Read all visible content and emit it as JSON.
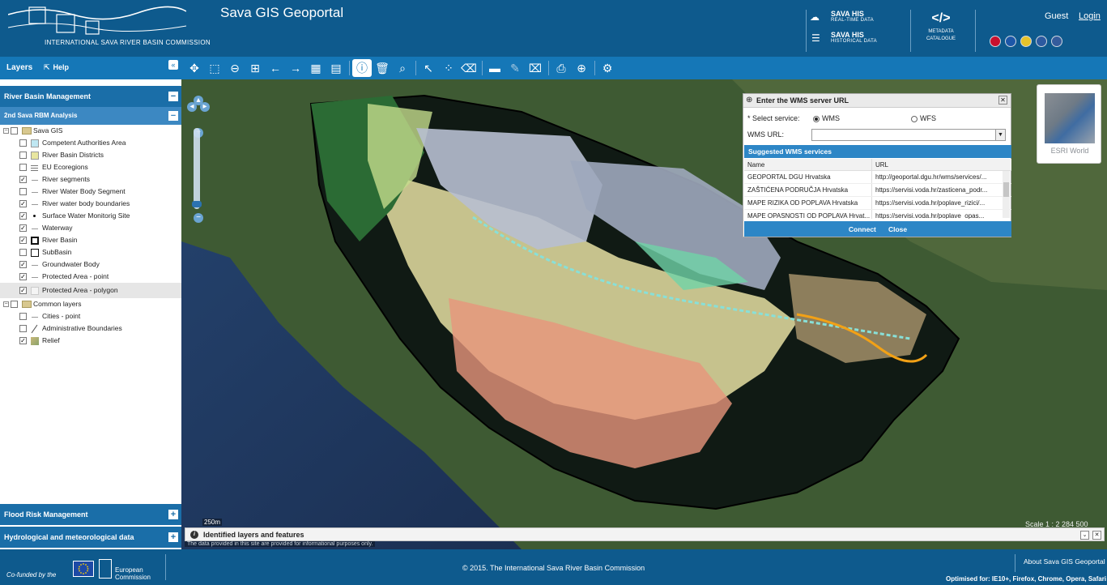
{
  "header": {
    "org_name": "INTERNATIONAL SAVA RIVER BASIN COMMISSION",
    "app_title": "Sava GIS Geoportal",
    "his_realtime": {
      "title": "SAVA HIS",
      "subtitle": "REAL-TIME DATA"
    },
    "his_historical": {
      "title": "SAVA HIS",
      "subtitle": "HISTORICAL DATA"
    },
    "metadata": {
      "glyph": "</>",
      "line1": "METADATA",
      "line2": "CATALOGUE"
    },
    "user": "Guest",
    "login": "Login",
    "flags": [
      "#c8102e",
      "#1d57a8",
      "#e6c229",
      "#2c5aa0",
      "#355c9c"
    ]
  },
  "toolbar": {
    "layers_tab": "Layers",
    "help_tab": "Help",
    "collapse": "«",
    "tools": [
      {
        "name": "pan-icon",
        "glyph": "✥"
      },
      {
        "name": "zoom-box-icon",
        "glyph": "⬚"
      },
      {
        "name": "zoom-out-icon",
        "glyph": "⊖"
      },
      {
        "name": "zoom-extent-icon",
        "glyph": "⊞"
      },
      {
        "name": "back-icon",
        "glyph": "←"
      },
      {
        "name": "forward-icon",
        "glyph": "→"
      },
      {
        "name": "map-icon",
        "glyph": "▦"
      },
      {
        "name": "table-icon",
        "glyph": "▤"
      },
      {
        "name": "info-icon",
        "glyph": "ⓘ",
        "active": true
      },
      {
        "name": "delete-icon",
        "glyph": "🗑"
      },
      {
        "name": "search-icon",
        "glyph": "⌕"
      },
      {
        "name": "select-icon",
        "glyph": "↖"
      },
      {
        "name": "select-area-icon",
        "glyph": "⁘"
      },
      {
        "name": "clear-selection-icon",
        "glyph": "⌫"
      },
      {
        "name": "measure-icon",
        "glyph": "▬"
      },
      {
        "name": "draw-icon",
        "glyph": "✎",
        "dim": true
      },
      {
        "name": "erase-icon",
        "glyph": "⌧"
      },
      {
        "name": "print-icon",
        "glyph": "⎙"
      },
      {
        "name": "globe-icon",
        "glyph": "⊕"
      },
      {
        "name": "gear-icon",
        "glyph": "⚙"
      }
    ]
  },
  "sidebar": {
    "river_basin": "River Basin Management",
    "rbm_analysis": "2nd Sava RBM Analysis",
    "flood_risk": "Flood Risk Management",
    "hydro": "Hydrological and meteorological data",
    "tree": [
      {
        "label": "Sava GIS",
        "level": 0,
        "folder": true,
        "checked": false
      },
      {
        "label": "Competent Authorities Area",
        "level": 1,
        "checked": false,
        "sym": "#bfe7f2"
      },
      {
        "label": "River Basin Districts",
        "level": 1,
        "checked": false,
        "sym": "#e8e6a0"
      },
      {
        "label": "EU Ecoregions",
        "level": 1,
        "checked": false,
        "sym": "lines"
      },
      {
        "label": "River segments",
        "level": 1,
        "checked": true,
        "sym": "line"
      },
      {
        "label": "River Water Body Segment",
        "level": 1,
        "checked": false,
        "sym": "line"
      },
      {
        "label": "River water body boundaries",
        "level": 1,
        "checked": true,
        "sym": "line"
      },
      {
        "label": "Surface Water Monitorig Site",
        "level": 1,
        "checked": true,
        "sym": "dot"
      },
      {
        "label": "Waterway",
        "level": 1,
        "checked": true,
        "sym": "line"
      },
      {
        "label": "River Basin",
        "level": 1,
        "checked": true,
        "sym": "bold"
      },
      {
        "label": "SubBasin",
        "level": 1,
        "checked": false,
        "sym": "box"
      },
      {
        "label": "Groundwater Body",
        "level": 1,
        "checked": true,
        "sym": "line"
      },
      {
        "label": "Protected Area - point",
        "level": 1,
        "checked": true,
        "sym": "line"
      },
      {
        "label": "Protected Area - polygon",
        "level": 1,
        "checked": true,
        "sym": "light",
        "selected": true
      },
      {
        "label": "Common layers",
        "level": 0,
        "folder": true,
        "checked": false
      },
      {
        "label": "Cities - point",
        "level": 1,
        "checked": false,
        "sym": "line"
      },
      {
        "label": "Administrative Boundaries",
        "level": 1,
        "checked": false,
        "sym": "slash"
      },
      {
        "label": "Relief",
        "level": 1,
        "checked": true,
        "sym": "relief"
      }
    ]
  },
  "map": {
    "basemap_label": "ESRI World",
    "scale_bar": "250m",
    "scale_text": "Scale 1 : 2 284 500",
    "disclaimer": "The data provided in this site are provided for informational purposes only."
  },
  "wms_dialog": {
    "title": "Enter the WMS server URL",
    "select_service": "* Select service:",
    "opt_wms": "WMS",
    "opt_wfs": "WFS",
    "wms_url_label": "WMS URL:",
    "suggested": "Suggested WMS services",
    "col_name": "Name",
    "col_url": "URL",
    "rows": [
      {
        "name": "GEOPORTAL DGU Hrvatska",
        "url": "http://geoportal.dgu.hr/wms/services/..."
      },
      {
        "name": "ZAŠTIĆENA PODRUČJA Hrvatska",
        "url": "https://servisi.voda.hr/zasticena_podr..."
      },
      {
        "name": "MAPE RIZIKA OD POPLAVA Hrvatska",
        "url": "https://servisi.voda.hr/poplave_rizici/..."
      },
      {
        "name": "MAPE OPASNOSTI OD POPLAVA Hrvat...",
        "url": "https://servisi.voda.hr/poplave_opas..."
      }
    ],
    "connect": "Connect",
    "close": "Close"
  },
  "identified": {
    "title": "Identified layers and features"
  },
  "footer": {
    "cofunded": "Co-funded by the",
    "ec_line1": "European",
    "ec_line2": "Commission",
    "copyright": "© 2015. The International Sava River Basin Commission",
    "about": "About Sava GIS Geoportal",
    "optimised": "Optimised for: IE10+, Firefox, Chrome, Opera, Safari"
  }
}
